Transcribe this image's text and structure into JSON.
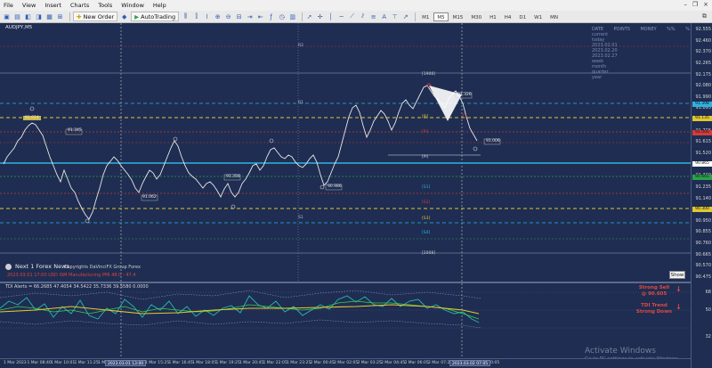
{
  "menubar": {
    "items": [
      "File",
      "View",
      "Insert",
      "Charts",
      "Tools",
      "Window",
      "Help"
    ]
  },
  "toolbar": {
    "new_order": "New Order",
    "autotrading": "AutoTrading",
    "timeframes": [
      "M1",
      "M5",
      "M15",
      "M30",
      "H1",
      "H4",
      "D1",
      "W1",
      "MN"
    ],
    "active_tf": "M5"
  },
  "chart": {
    "symbol": "AUDJPY,M5",
    "stats": {
      "headers": [
        "DATE",
        "POINTS",
        "MONEY",
        "%%",
        "%"
      ],
      "rows": [
        [
          "current",
          "",
          "",
          "",
          ""
        ],
        [
          "today",
          "",
          "",
          "",
          ""
        ],
        [
          "2023.02.01",
          "",
          "",
          "",
          ""
        ],
        [
          "2023.02.20",
          "",
          "",
          "",
          ""
        ],
        [
          "2023.02.27",
          "",
          "",
          "",
          ""
        ],
        [
          "week",
          "",
          "",
          "",
          ""
        ],
        [
          "month",
          "",
          "",
          "",
          ""
        ],
        [
          "quarter",
          "",
          "",
          "",
          ""
        ],
        [
          "year",
          "",
          "",
          "",
          ""
        ]
      ]
    },
    "price_labels": [
      "92.555",
      "92.460",
      "92.370",
      "92.265",
      "92.175",
      "92.080",
      "91.990",
      "91.895",
      "91.800",
      "91.705",
      "91.615",
      "91.520",
      "91.425",
      "91.330",
      "91.235",
      "91.140",
      "91.045",
      "90.950",
      "90.855",
      "90.760",
      "90.665",
      "90.570",
      "90.475"
    ],
    "price_tags": [
      {
        "label": "91.398",
        "color": "#2fb3e0"
      },
      {
        "label": "91.135",
        "color": "#e0c832"
      },
      {
        "label": "91.000",
        "color": "#d23c3c"
      },
      {
        "label": "90.865",
        "color": "#ffffff"
      },
      {
        "label": "90.665",
        "color": "#2aa24a"
      },
      {
        "label": "90.300",
        "color": "#e0c832"
      }
    ],
    "level_labels": [
      "[1908]",
      "[Pi]",
      "[Pi]",
      "[Pi]",
      "[S1]",
      "[S2]",
      "[S3]",
      "[S4]",
      "[2008]"
    ],
    "high_labels": [
      "91.345",
      "91.356",
      "91.326"
    ],
    "low_labels": [
      "91.062",
      "90.986",
      "91.006",
      "91.024"
    ],
    "pivots": [
      "R2",
      "R1",
      "S1"
    ],
    "news": {
      "title": "Next 1 Forex News",
      "copyright": "Copyrights DaVinciFX Group Forex",
      "line": "2023.03.01 17:00  USD ISM Manufacturing PMI   48.0   -    47.4"
    },
    "show_button": "Show",
    "indicator": {
      "label": "TDI Alerts = 66.2685 47.4054 34.5422 35.7336 39.5580 0.0000",
      "signal1": [
        "Strong Sell",
        "@ 90.605"
      ],
      "signal2": [
        "TDI Trend",
        "Strong Down"
      ],
      "levels": [
        "68",
        "50",
        "32"
      ]
    },
    "time_labels": [
      "1 Mar 2023",
      "1 Mar 08:40",
      "1 Mar 10:01",
      "1 Mar 11:25",
      "1 Mar 12:5",
      "1 Mar 14:10",
      "1 Mar 15:25",
      "1 Mar 16:45",
      "1 Mar 18:05",
      "1 Mar 19:25",
      "1 Mar 20:45",
      "1 Mar 22:05",
      "1 Mar 23:25",
      "2 Mar 00:45",
      "2 Mar 02:05",
      "2 Mar 03:25",
      "2 Mar 04:45",
      "2 Mar 06:05",
      "2 Mar 07:25",
      "2 Mar 08:45",
      "2 Mar 10:05"
    ],
    "time_marks": [
      "2023.03.01 13:00",
      "2023.03.02 07:05"
    ]
  },
  "windows_watermark": {
    "line1": "Activate Windows",
    "line2": "Go to PC settings to activate Windows."
  }
}
